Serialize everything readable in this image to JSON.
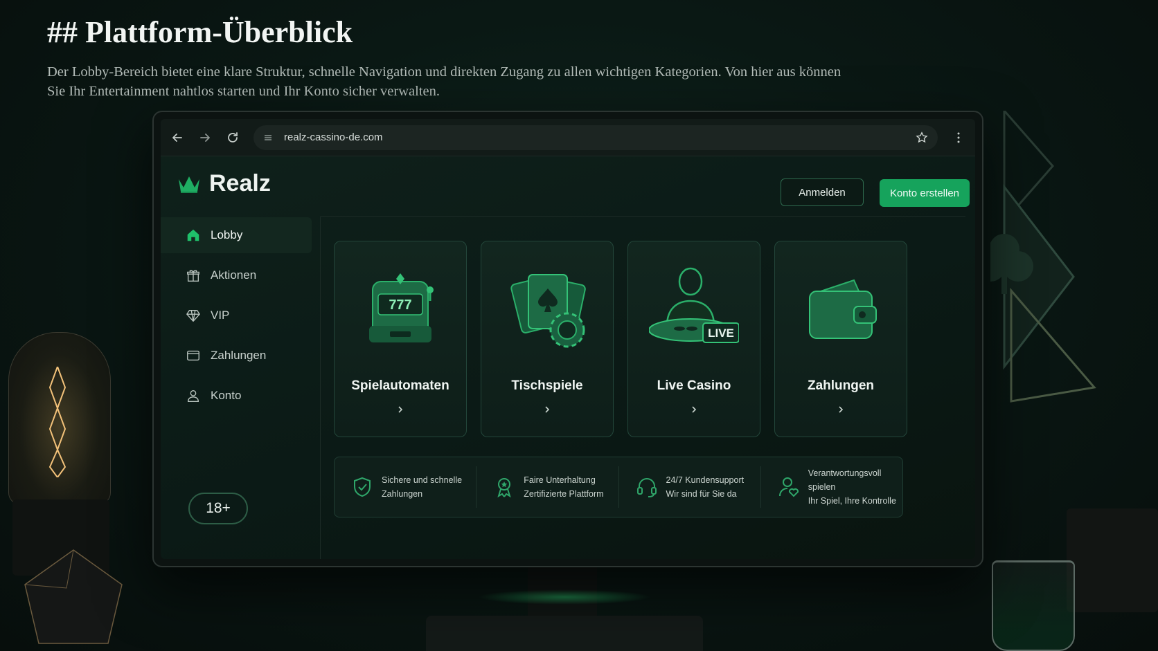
{
  "intro": {
    "title": "## Plattform-Überblick",
    "description": "Der Lobby-Bereich bietet eine klare Struktur, schnelle Navigation und direkten Zugang zu allen wichtigen Kategorien. Von hier aus können Sie Ihr Entertainment nahtlos starten und Ihr Konto sicher verwalten."
  },
  "browser": {
    "url": "realz-cassino-de.com"
  },
  "header": {
    "brand": "Realz",
    "login_label": "Anmelden",
    "register_label": "Konto erstellen"
  },
  "sidebar": {
    "items": [
      {
        "label": "Lobby",
        "icon": "home-icon",
        "active": true
      },
      {
        "label": "Aktionen",
        "icon": "gift-icon",
        "active": false
      },
      {
        "label": "VIP",
        "icon": "diamond-icon",
        "active": false
      },
      {
        "label": "Zahlungen",
        "icon": "card-icon",
        "active": false
      },
      {
        "label": "Konto",
        "icon": "user-icon",
        "active": false
      }
    ],
    "age_badge": "18+"
  },
  "categories": [
    {
      "title": "Spielautomaten",
      "icon": "slot-machine-icon",
      "reels": "777"
    },
    {
      "title": "Tischspiele",
      "icon": "playing-cards-chip-icon"
    },
    {
      "title": "Live Casino",
      "icon": "live-dealer-icon",
      "badge": "LIVE"
    },
    {
      "title": "Zahlungen",
      "icon": "wallet-icon"
    }
  ],
  "trust": [
    {
      "line1": "Sichere und schnelle",
      "line2": "Zahlungen",
      "icon": "shield-check-icon"
    },
    {
      "line1": "Faire Unterhaltung",
      "line2": "Zertifizierte Plattform",
      "icon": "award-ribbon-icon"
    },
    {
      "line1": "24/7 Kundensupport",
      "line2": "Wir sind für Sie da",
      "icon": "headset-icon"
    },
    {
      "line1": "Verantwortungsvoll spielen",
      "line2": "Ihr Spiel, Ihre Kontrolle",
      "icon": "user-heart-icon"
    }
  ],
  "colors": {
    "accent": "#16a35c",
    "background": "#0a1814",
    "card_border": "#23463a"
  }
}
